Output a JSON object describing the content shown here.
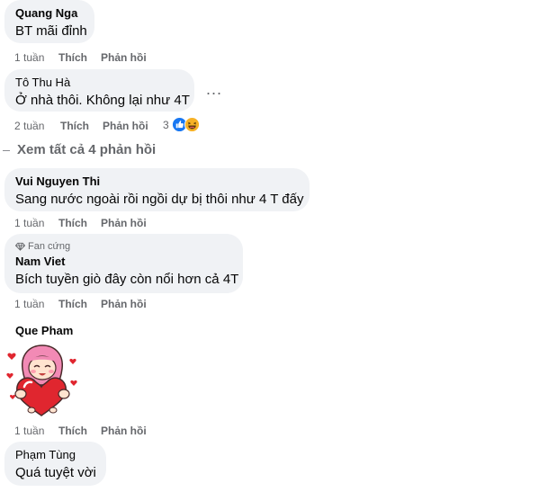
{
  "colors": {
    "bubble": "#f0f2f5",
    "meta": "#65676b",
    "like_blue": "#1877f2",
    "haha_yellow": "#f7b125"
  },
  "comments": [
    {
      "name": "Quang Nga",
      "text": "BT mãi đỉnh",
      "time": "1 tuần",
      "like": "Thích",
      "reply": "Phản hồi"
    },
    {
      "name": "Tô Thu Hà",
      "text": "Ở nhà thôi. Không lại như 4T",
      "time": "2 tuần",
      "like": "Thích",
      "reply": "Phản hồi",
      "reaction_count": "3",
      "reaction_icons": [
        "like-icon",
        "haha-icon"
      ]
    },
    {
      "name": "Vui Nguyen Thi",
      "text": "Sang nước ngoài rồi ngồi dự bị thôi như 4 T đấy",
      "time": "1 tuần",
      "like": "Thích",
      "reply": "Phản hồi"
    },
    {
      "badge": "Fan cứng",
      "name": "Nam Viet",
      "text": "Bích tuyền giò đây còn nổi hơn cả 4T",
      "time": "1 tuần",
      "like": "Thích",
      "reply": "Phản hồi"
    },
    {
      "name": "Que Pham",
      "sticker": "girl-hugging-heart-sticker",
      "time": "1 tuần",
      "like": "Thích",
      "reply": "Phản hồi"
    },
    {
      "name": "Phạm Tùng",
      "text": "Quá tuyệt vời"
    }
  ],
  "view_all": "Xem tất cả 4 phản hồi",
  "more_label": "..."
}
